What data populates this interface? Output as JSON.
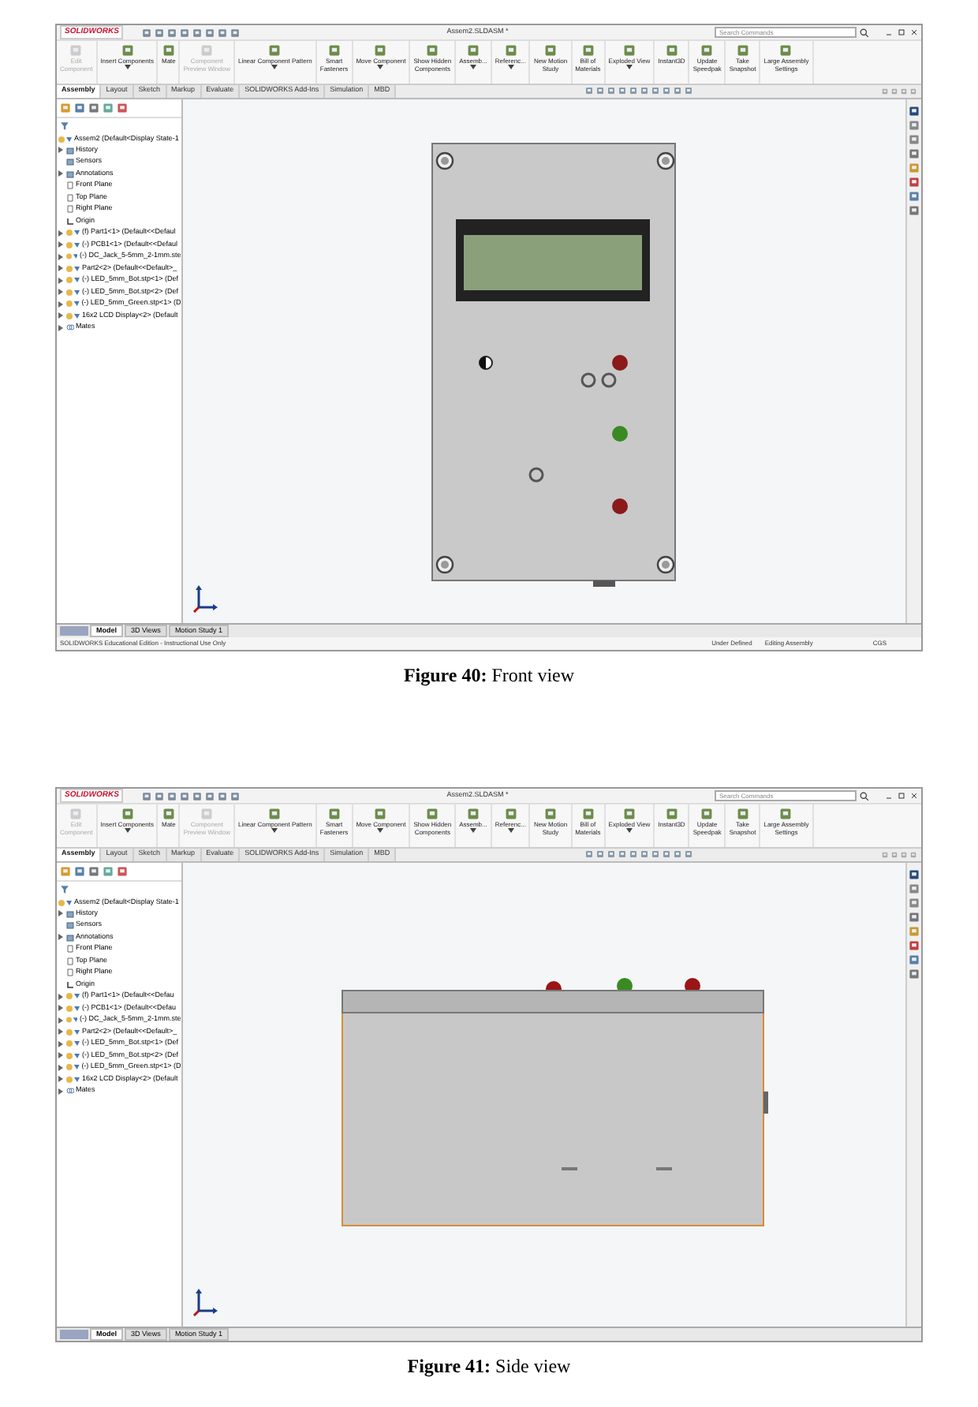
{
  "figures": [
    {
      "kind": "front",
      "app": {
        "logo": "SOLIDWORKS",
        "document_title": "Assem2.SLDASM *",
        "search_placeholder": "Search Commands",
        "ribbon": [
          {
            "lines": [
              "Edit",
              "Component"
            ],
            "disabled": true,
            "dropdown": false
          },
          {
            "lines": [
              "Insert Components"
            ],
            "disabled": false,
            "dropdown": true
          },
          {
            "lines": [
              "Mate"
            ],
            "disabled": false,
            "dropdown": false
          },
          {
            "lines": [
              "Component",
              "Preview Window"
            ],
            "disabled": true,
            "dropdown": false
          },
          {
            "lines": [
              "Linear Component Pattern"
            ],
            "disabled": false,
            "dropdown": true
          },
          {
            "lines": [
              "Smart",
              "Fasteners"
            ],
            "disabled": false,
            "dropdown": false
          },
          {
            "lines": [
              "Move Component"
            ],
            "disabled": false,
            "dropdown": true
          },
          {
            "lines": [
              "Show Hidden",
              "Components"
            ],
            "disabled": false,
            "dropdown": false
          },
          {
            "lines": [
              "Assemb..."
            ],
            "disabled": false,
            "dropdown": true
          },
          {
            "lines": [
              "Referenc..."
            ],
            "disabled": false,
            "dropdown": true
          },
          {
            "lines": [
              "New Motion",
              "Study"
            ],
            "disabled": false,
            "dropdown": false
          },
          {
            "lines": [
              "Bill of",
              "Materials"
            ],
            "disabled": false,
            "dropdown": false
          },
          {
            "lines": [
              "Exploded View"
            ],
            "disabled": false,
            "dropdown": true
          },
          {
            "lines": [
              "Instant3D"
            ],
            "disabled": false,
            "dropdown": false
          },
          {
            "lines": [
              "Update",
              "Speedpak"
            ],
            "disabled": false,
            "dropdown": false
          },
          {
            "lines": [
              "Take",
              "Snapshot"
            ],
            "disabled": false,
            "dropdown": false
          },
          {
            "lines": [
              "Large Assembly",
              "Settings"
            ],
            "disabled": false,
            "dropdown": false
          }
        ],
        "tabs": [
          {
            "label": "Assembly",
            "selected": true
          },
          {
            "label": "Layout",
            "selected": false
          },
          {
            "label": "Sketch",
            "selected": false
          },
          {
            "label": "Markup",
            "selected": false
          },
          {
            "label": "Evaluate",
            "selected": false
          },
          {
            "label": "SOLIDWORKS Add-Ins",
            "selected": false
          },
          {
            "label": "Simulation",
            "selected": false
          },
          {
            "label": "MBD",
            "selected": false
          }
        ],
        "tree": {
          "label": "Assem2  (Default<Display State-1",
          "children": [
            {
              "kind": "folder",
              "label": "History",
              "expandable": true
            },
            {
              "kind": "folder",
              "label": "Sensors",
              "expandable": false
            },
            {
              "kind": "folder",
              "label": "Annotations",
              "expandable": true
            },
            {
              "kind": "plane",
              "label": "Front Plane",
              "expandable": false
            },
            {
              "kind": "plane",
              "label": "Top Plane",
              "expandable": false
            },
            {
              "kind": "plane",
              "label": "Right Plane",
              "expandable": false
            },
            {
              "kind": "origin",
              "label": "Origin",
              "expandable": false
            },
            {
              "kind": "part",
              "label": "(f) Part1<1> (Default<<Defaul",
              "expandable": true
            },
            {
              "kind": "part",
              "label": "(-) PCB1<1> (Default<<Defaul",
              "expandable": true
            },
            {
              "kind": "part",
              "label": "(-) DC_Jack_5-5mm_2-1mm.ste",
              "expandable": true
            },
            {
              "kind": "part",
              "label": "Part2<2> (Default<<Default>_",
              "expandable": true
            },
            {
              "kind": "part",
              "label": "(-) LED_5mm_Bot.stp<1> (Def",
              "expandable": true
            },
            {
              "kind": "part",
              "label": "(-) LED_5mm_Bot.stp<2> (Def",
              "expandable": true
            },
            {
              "kind": "part",
              "label": "(-) LED_5mm_Green.stp<1> (D",
              "expandable": true
            },
            {
              "kind": "part",
              "label": "16x2 LCD Display<2> (Default",
              "expandable": true
            },
            {
              "kind": "mates",
              "label": "Mates",
              "expandable": true
            }
          ]
        },
        "bottom_tabs": [
          {
            "label": "Model",
            "selected": true
          },
          {
            "label": "3D Views",
            "selected": false
          },
          {
            "label": "Motion Study 1",
            "selected": false
          }
        ],
        "status_bar": {
          "edition": "SOLIDWORKS Educational Edition - Instructional Use Only",
          "state": "Under Defined",
          "mode": "Editing Assembly",
          "units": "CGS"
        }
      },
      "caption": {
        "label": "Figure 40:",
        "title": "Front view"
      }
    },
    {
      "kind": "side",
      "app": {
        "logo": "SOLIDWORKS",
        "document_title": "Assem2.SLDASM *",
        "search_placeholder": "Search Commands",
        "ribbon": [
          {
            "lines": [
              "Edit",
              "Component"
            ],
            "disabled": true,
            "dropdown": false
          },
          {
            "lines": [
              "Insert Components"
            ],
            "disabled": false,
            "dropdown": true
          },
          {
            "lines": [
              "Mate"
            ],
            "disabled": false,
            "dropdown": false
          },
          {
            "lines": [
              "Component",
              "Preview Window"
            ],
            "disabled": true,
            "dropdown": false
          },
          {
            "lines": [
              "Linear Component Pattern"
            ],
            "disabled": false,
            "dropdown": true
          },
          {
            "lines": [
              "Smart",
              "Fasteners"
            ],
            "disabled": false,
            "dropdown": false
          },
          {
            "lines": [
              "Move Component"
            ],
            "disabled": false,
            "dropdown": true
          },
          {
            "lines": [
              "Show Hidden",
              "Components"
            ],
            "disabled": false,
            "dropdown": false
          },
          {
            "lines": [
              "Assemb..."
            ],
            "disabled": false,
            "dropdown": true
          },
          {
            "lines": [
              "Referenc..."
            ],
            "disabled": false,
            "dropdown": true
          },
          {
            "lines": [
              "New Motion",
              "Study"
            ],
            "disabled": false,
            "dropdown": false
          },
          {
            "lines": [
              "Bill of",
              "Materials"
            ],
            "disabled": false,
            "dropdown": false
          },
          {
            "lines": [
              "Exploded View"
            ],
            "disabled": false,
            "dropdown": true
          },
          {
            "lines": [
              "Instant3D"
            ],
            "disabled": false,
            "dropdown": false
          },
          {
            "lines": [
              "Update",
              "Speedpak"
            ],
            "disabled": false,
            "dropdown": false
          },
          {
            "lines": [
              "Take",
              "Snapshot"
            ],
            "disabled": false,
            "dropdown": false
          },
          {
            "lines": [
              "Large Assembly",
              "Settings"
            ],
            "disabled": false,
            "dropdown": false
          }
        ],
        "tabs": [
          {
            "label": "Assembly",
            "selected": true
          },
          {
            "label": "Layout",
            "selected": false
          },
          {
            "label": "Sketch",
            "selected": false
          },
          {
            "label": "Markup",
            "selected": false
          },
          {
            "label": "Evaluate",
            "selected": false
          },
          {
            "label": "SOLIDWORKS Add-Ins",
            "selected": false
          },
          {
            "label": "Simulation",
            "selected": false
          },
          {
            "label": "MBD",
            "selected": false
          }
        ],
        "tree": {
          "label": "Assem2  (Default<Display State-1",
          "children": [
            {
              "kind": "folder",
              "label": "History",
              "expandable": true
            },
            {
              "kind": "folder",
              "label": "Sensors",
              "expandable": false
            },
            {
              "kind": "folder",
              "label": "Annotations",
              "expandable": true
            },
            {
              "kind": "plane",
              "label": "Front Plane",
              "expandable": false
            },
            {
              "kind": "plane",
              "label": "Top Plane",
              "expandable": false
            },
            {
              "kind": "plane",
              "label": "Right Plane",
              "expandable": false
            },
            {
              "kind": "origin",
              "label": "Origin",
              "expandable": false
            },
            {
              "kind": "part",
              "label": "(f) Part1<1> (Default<<Defau",
              "expandable": true
            },
            {
              "kind": "part",
              "label": "(-) PCB1<1> (Default<<Defau",
              "expandable": true
            },
            {
              "kind": "part",
              "label": "(-) DC_Jack_5-5mm_2-1mm.ste",
              "expandable": true
            },
            {
              "kind": "part",
              "label": "Part2<2> (Default<<Default>_",
              "expandable": true
            },
            {
              "kind": "part",
              "label": "(-) LED_5mm_Bot.stp<1> (Def",
              "expandable": true
            },
            {
              "kind": "part",
              "label": "(-) LED_5mm_Bot.stp<2> (Def",
              "expandable": true
            },
            {
              "kind": "part",
              "label": "(-) LED_5mm_Green.stp<1> (D",
              "expandable": true
            },
            {
              "kind": "part",
              "label": "16x2 LCD Display<2> (Default",
              "expandable": true
            },
            {
              "kind": "mates",
              "label": "Mates",
              "expandable": true
            }
          ]
        },
        "bottom_tabs": [
          {
            "label": "Model",
            "selected": true
          },
          {
            "label": "3D Views",
            "selected": false
          },
          {
            "label": "Motion Study 1",
            "selected": false
          }
        ]
      },
      "caption": {
        "label": "Figure 41:",
        "title": "Side view"
      }
    }
  ]
}
